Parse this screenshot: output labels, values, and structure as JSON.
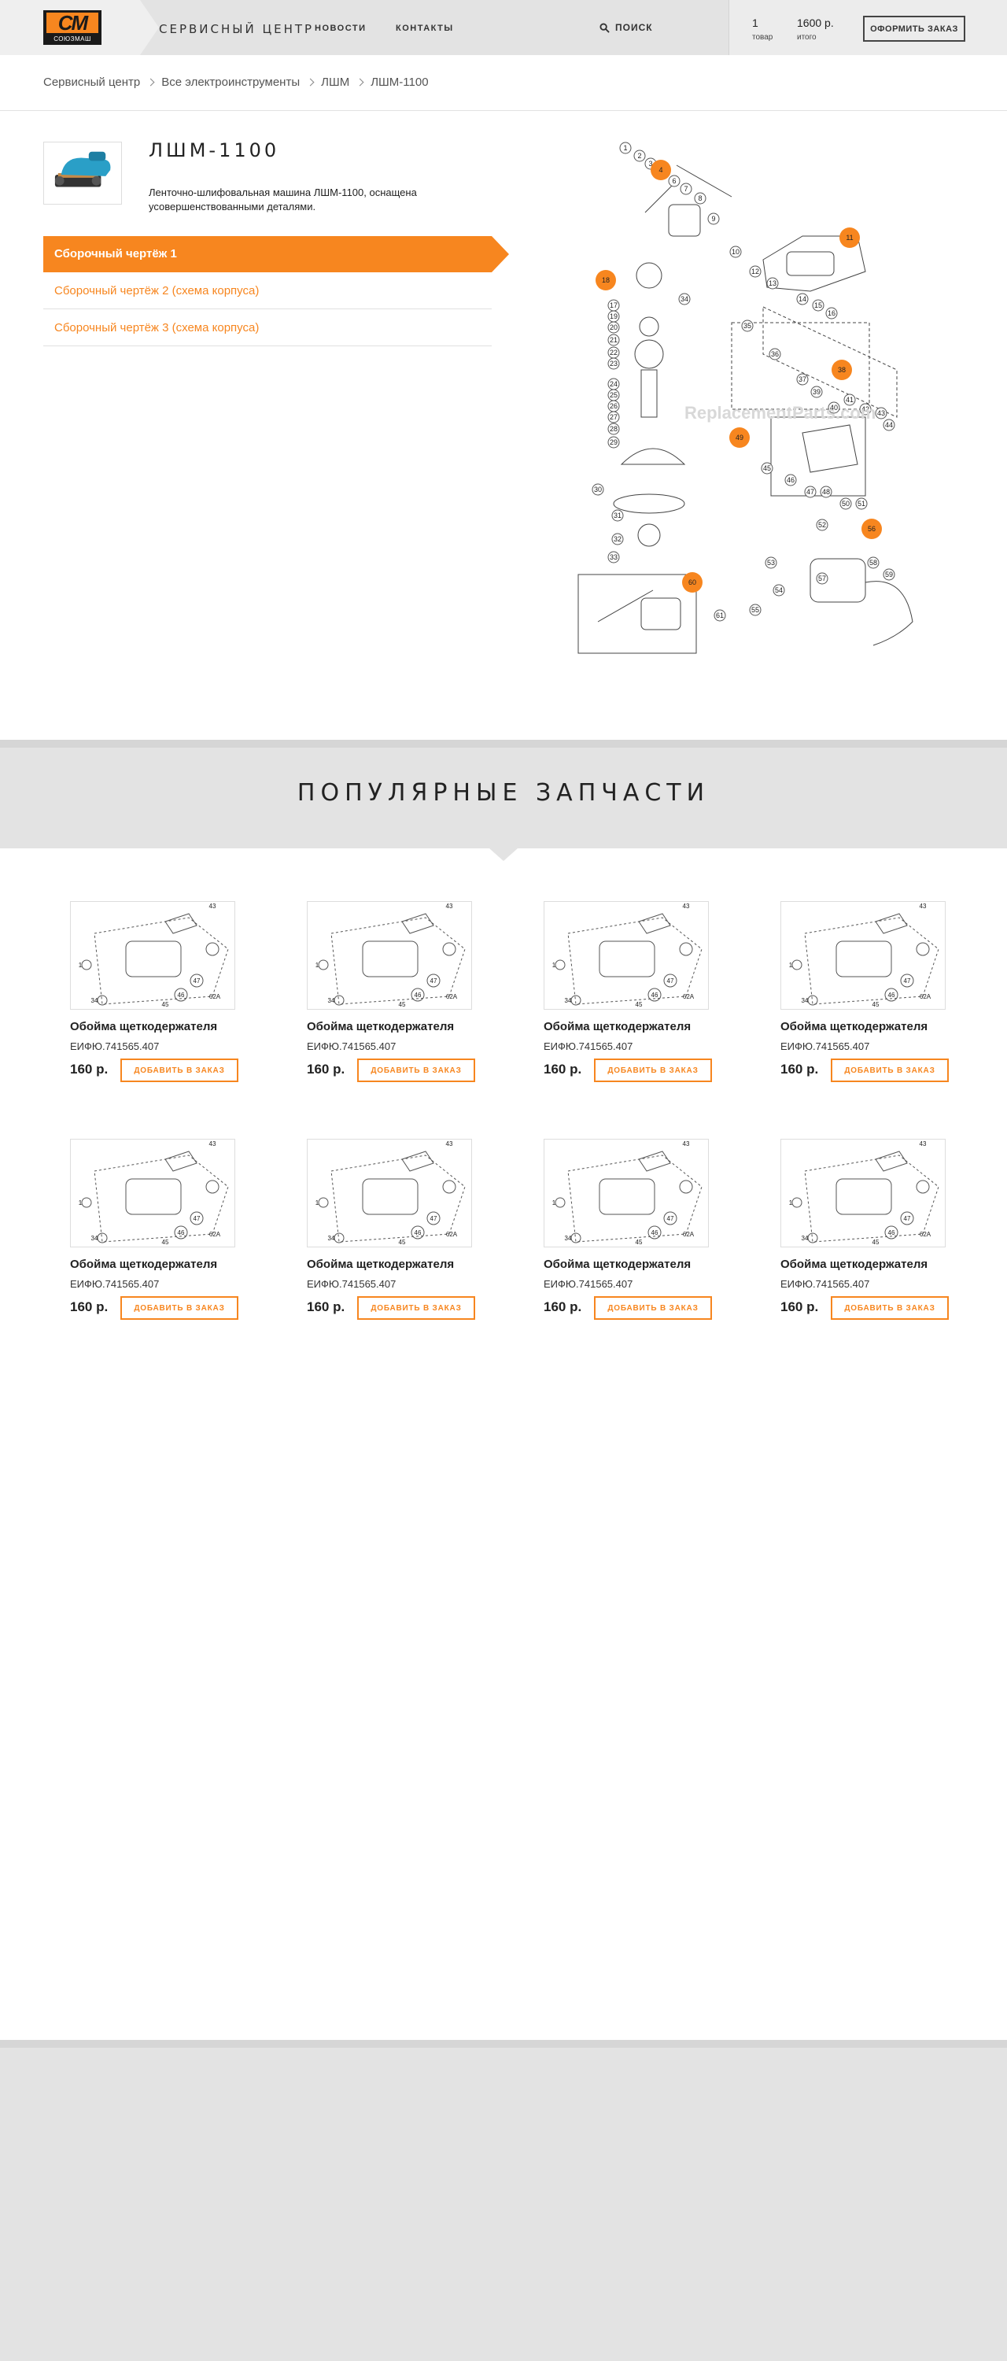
{
  "header": {
    "logo_mark": "СМ",
    "logo_text": "СОЮЗМАШ",
    "site_title": "СЕРВИСНЫЙ ЦЕНТР",
    "nav": [
      "НОВОСТИ",
      "КОНТАКТЫ"
    ],
    "search_label": "ПОИСК",
    "cart": {
      "count": "1",
      "count_label": "товар",
      "total": "1600 р.",
      "total_label": "итого",
      "checkout_label": "ОФОРМИТЬ ЗАКАЗ"
    }
  },
  "breadcrumb": [
    "Сервисный центр",
    "Все электроинструменты",
    "ЛШМ",
    "ЛШМ-1100"
  ],
  "product": {
    "title": "ЛШМ-1100",
    "description": "Ленточно-шлифовальная машина ЛШМ-1100, оснащена усовершенствованными деталями.",
    "tabs": [
      "Сборочный чертёж 1",
      "Сборочный чертёж 2 (схема корпуса)",
      "Сборочный чертёж 3 (схема корпуса)"
    ],
    "active_tab": 0
  },
  "diagram": {
    "watermark": "ReplacementParts.com",
    "highlighted_labels": [
      "4",
      "11",
      "18",
      "38",
      "49",
      "56",
      "60"
    ],
    "labels": [
      "1",
      "2",
      "3",
      "5",
      "6",
      "7",
      "8",
      "9",
      "10",
      "12",
      "13",
      "14",
      "15",
      "16",
      "17",
      "19",
      "20",
      "21",
      "22",
      "23",
      "24",
      "25",
      "26",
      "27",
      "28",
      "29",
      "30",
      "31",
      "32",
      "33",
      "34",
      "35",
      "36",
      "37",
      "39",
      "40",
      "41",
      "42",
      "43",
      "44",
      "45",
      "46",
      "47",
      "48",
      "50",
      "51",
      "52",
      "53",
      "54",
      "55",
      "57",
      "58",
      "59",
      "61"
    ]
  },
  "popular": {
    "title": "ПОПУЛЯРНЫЕ ЗАПЧАСТИ",
    "items": [
      {
        "name": "Обойма щеткодержателя",
        "code": "ЕИФЮ.741565.407",
        "price": "160 р.",
        "button": "ДОБАВИТЬ В ЗАКАЗ"
      },
      {
        "name": "Обойма щеткодержателя",
        "code": "ЕИФЮ.741565.407",
        "price": "160 р.",
        "button": "ДОБАВИТЬ В ЗАКАЗ"
      },
      {
        "name": "Обойма щеткодержателя",
        "code": "ЕИФЮ.741565.407",
        "price": "160 р.",
        "button": "ДОБАВИТЬ В ЗАКАЗ"
      },
      {
        "name": "Обойма щеткодержателя",
        "code": "ЕИФЮ.741565.407",
        "price": "160 р.",
        "button": "ДОБАВИТЬ В ЗАКАЗ"
      },
      {
        "name": "Обойма щеткодержателя",
        "code": "ЕИФЮ.741565.407",
        "price": "160 р.",
        "button": "ДОБАВИТЬ В ЗАКАЗ"
      },
      {
        "name": "Обойма щеткодержателя",
        "code": "ЕИФЮ.741565.407",
        "price": "160 р.",
        "button": "ДОБАВИТЬ В ЗАКАЗ"
      },
      {
        "name": "Обойма щеткодержателя",
        "code": "ЕИФЮ.741565.407",
        "price": "160 р.",
        "button": "ДОБАВИТЬ В ЗАКАЗ"
      },
      {
        "name": "Обойма щеткодержателя",
        "code": "ЕИФЮ.741565.407",
        "price": "160 р.",
        "button": "ДОБАВИТЬ В ЗАКАЗ"
      }
    ]
  },
  "colors": {
    "accent": "#f7861f",
    "header_bg": "#e3e3e3",
    "text": "#222222"
  }
}
